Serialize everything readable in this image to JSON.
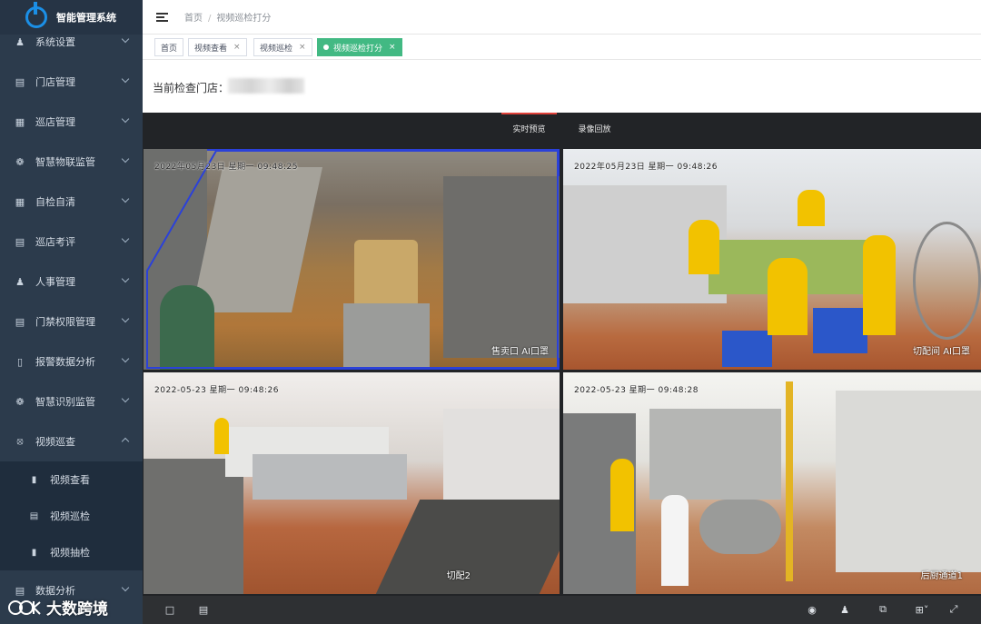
{
  "app": {
    "title": "智能管理系统"
  },
  "sidebar": {
    "items": [
      {
        "label": "系统设置",
        "icon": "user-gear-icon"
      },
      {
        "label": "门店管理",
        "icon": "store-icon"
      },
      {
        "label": "巡店管理",
        "icon": "grid-icon"
      },
      {
        "label": "智慧物联监管",
        "icon": "iot-icon"
      },
      {
        "label": "自检自清",
        "icon": "checklist-icon"
      },
      {
        "label": "巡店考评",
        "icon": "evaluation-icon"
      },
      {
        "label": "人事管理",
        "icon": "people-icon"
      },
      {
        "label": "门禁权限管理",
        "icon": "access-icon"
      },
      {
        "label": "报警数据分析",
        "icon": "alarm-doc-icon"
      },
      {
        "label": "智慧识别监管",
        "icon": "recognition-icon"
      },
      {
        "label": "视频巡查",
        "icon": "video-icon"
      }
    ],
    "subitems": [
      {
        "label": "视频查看",
        "icon": "file-icon"
      },
      {
        "label": "视频巡检",
        "icon": "inspect-icon"
      },
      {
        "label": "视频抽检",
        "icon": "sample-icon"
      }
    ],
    "last_item": {
      "label": "数据分析",
      "icon": "chart-icon"
    }
  },
  "header": {
    "breadcrumb": [
      "首页",
      "视频巡检打分"
    ]
  },
  "tags": [
    {
      "label": "首页",
      "closable": false
    },
    {
      "label": "视频查看",
      "closable": true
    },
    {
      "label": "视频巡检",
      "closable": true
    },
    {
      "label": "视频巡检打分",
      "closable": true,
      "active": true
    }
  ],
  "store": {
    "label": "当前检查门店："
  },
  "video": {
    "tabs": [
      "实时预览",
      "录像回放"
    ],
    "cameras": [
      {
        "timestamp": "2022年05月23日  星期一  09:48:25",
        "name": "售卖口 AI口罩"
      },
      {
        "timestamp": "2022年05月23日  星期一  09:48:26",
        "name": "切配间 AI口罩"
      },
      {
        "timestamp": "2022-05-23  星期一  09:48:26",
        "name": "切配2"
      },
      {
        "timestamp": "2022-05-23  星期一  09:48:28",
        "name": "后厨通道1"
      }
    ]
  },
  "watermark": {
    "text": "大数跨境"
  },
  "colors": {
    "sidebar_bg": "#2c3b4c",
    "active_tag": "#42b983",
    "tab_accent": "#e0413a",
    "selection": "#2b41d9"
  }
}
